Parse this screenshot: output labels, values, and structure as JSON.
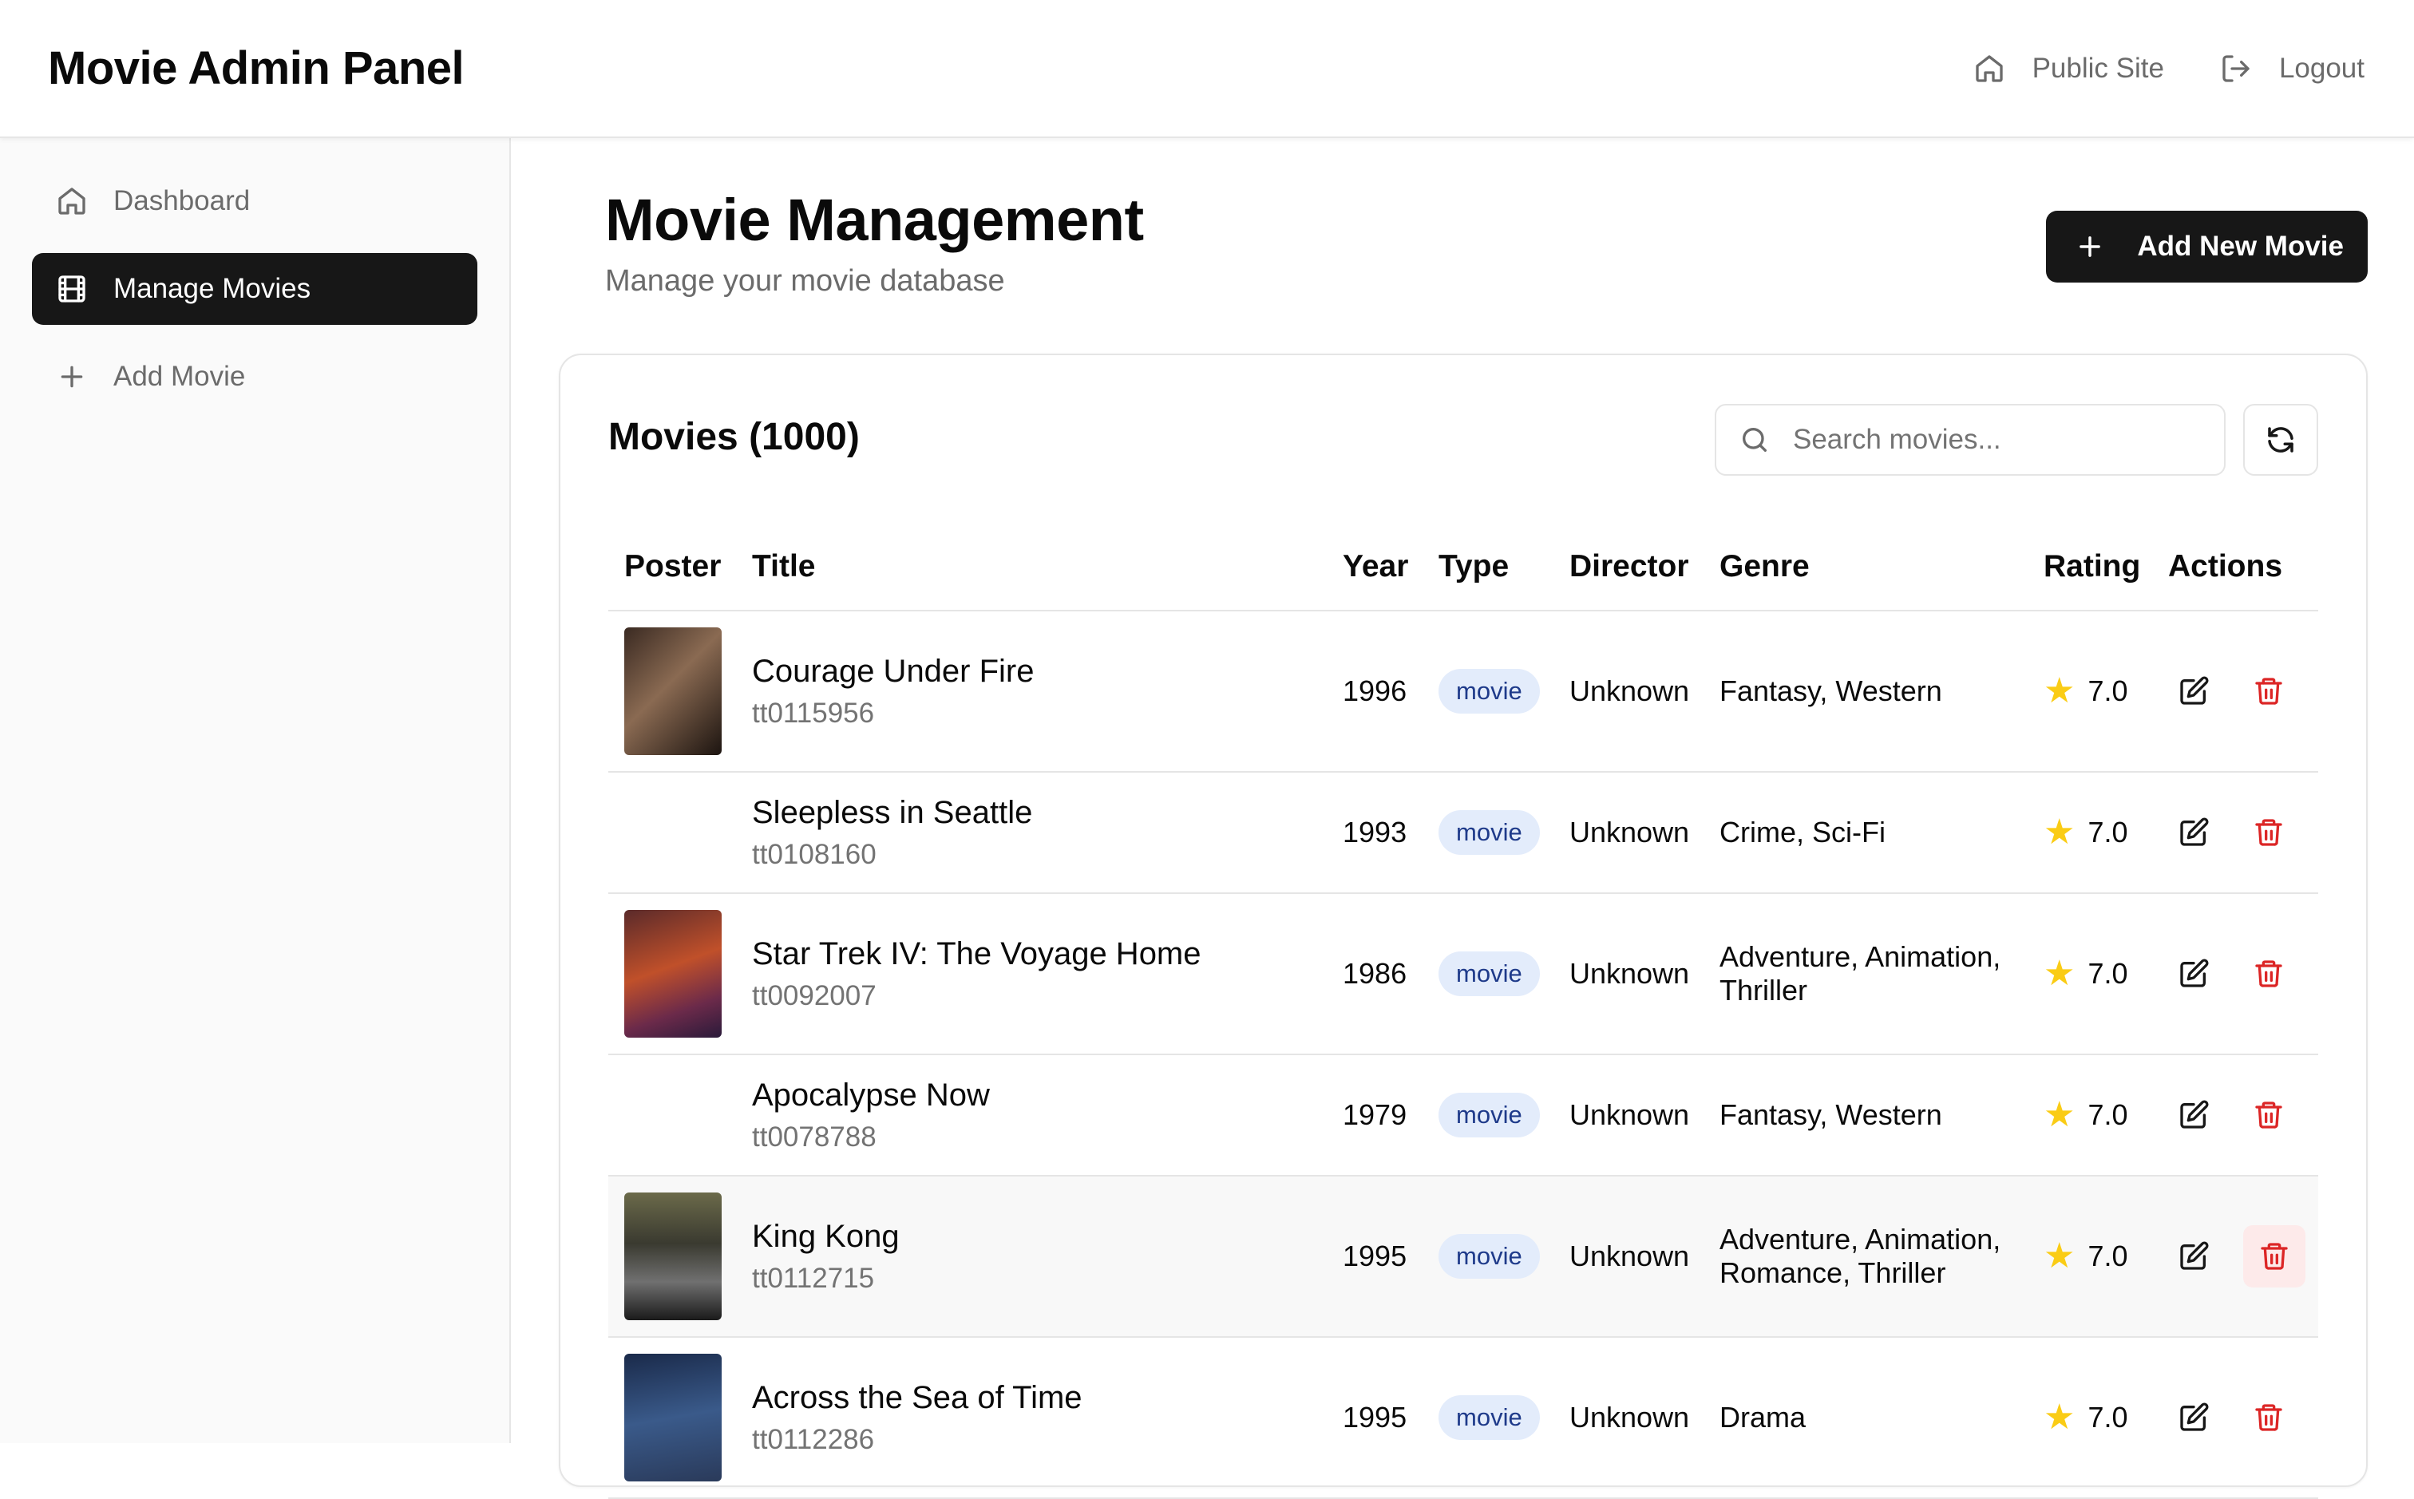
{
  "header": {
    "app_title": "Movie Admin Panel",
    "public_site_label": "Public Site",
    "logout_label": "Logout"
  },
  "sidebar": {
    "items": [
      {
        "label": "Dashboard",
        "icon": "home-icon",
        "active": false
      },
      {
        "label": "Manage Movies",
        "icon": "film-icon",
        "active": true
      },
      {
        "label": "Add Movie",
        "icon": "plus-icon",
        "active": false
      }
    ]
  },
  "page": {
    "title": "Movie Management",
    "subtitle": "Manage your movie database",
    "add_button_label": "Add New Movie"
  },
  "movies_card": {
    "title": "Movies (1000)",
    "search_placeholder": "Search movies..."
  },
  "table": {
    "columns": [
      "Poster",
      "Title",
      "Year",
      "Type",
      "Director",
      "Genre",
      "Rating",
      "Actions"
    ],
    "rows": [
      {
        "title": "Courage Under Fire",
        "id": "tt0115956",
        "year": "1996",
        "type": "movie",
        "director": "Unknown",
        "genre": "Fantasy, Western",
        "rating": "7.0",
        "poster": "dark"
      },
      {
        "title": "Sleepless in Seattle",
        "id": "tt0108160",
        "year": "1993",
        "type": "movie",
        "director": "Unknown",
        "genre": "Crime, Sci-Fi",
        "rating": "7.0",
        "poster": "none"
      },
      {
        "title": "Star Trek IV: The Voyage Home",
        "id": "tt0092007",
        "year": "1986",
        "type": "movie",
        "director": "Unknown",
        "genre": "Adventure, Animation, Thriller",
        "rating": "7.0",
        "poster": "red"
      },
      {
        "title": "Apocalypse Now",
        "id": "tt0078788",
        "year": "1979",
        "type": "movie",
        "director": "Unknown",
        "genre": "Fantasy, Western",
        "rating": "7.0",
        "poster": "none"
      },
      {
        "title": "King Kong",
        "id": "tt0112715",
        "year": "1995",
        "type": "movie",
        "director": "Unknown",
        "genre": "Adventure, Animation, Romance, Thriller",
        "rating": "7.0",
        "poster": "gray"
      },
      {
        "title": "Across the Sea of Time",
        "id": "tt0112286",
        "year": "1995",
        "type": "movie",
        "director": "Unknown",
        "genre": "Drama",
        "rating": "7.0",
        "poster": "blue"
      }
    ]
  },
  "colors": {
    "primary": "#171717",
    "badge_bg": "#e3ecfb",
    "badge_text": "#1e3a8a",
    "delete": "#dc2626",
    "star": "#facc15"
  }
}
